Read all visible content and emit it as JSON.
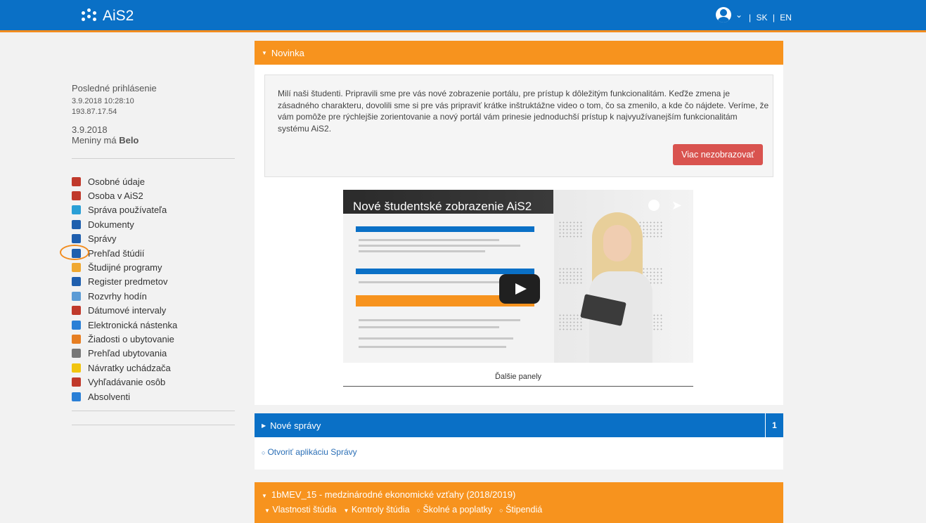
{
  "header": {
    "app_title": "AiS2",
    "lang_sep": "|",
    "lang_sk": "SK",
    "lang_en": "EN"
  },
  "sidebar": {
    "last_login_label": "Posledné prihlásenie",
    "last_login_time": "3.9.2018 10:28:10",
    "ip": "193.87.17.54",
    "date": "3.9.2018",
    "nameday_prefix": "Meniny má",
    "nameday_name": "Belo",
    "items": [
      {
        "label": "Osobné údaje",
        "color": "#c0392b"
      },
      {
        "label": "Osoba v AiS2",
        "color": "#c0392b"
      },
      {
        "label": "Správa používateľa",
        "color": "#2a9fd6"
      },
      {
        "label": "Dokumenty",
        "color": "#1f5fae"
      },
      {
        "label": "Správy",
        "color": "#1f5fae"
      },
      {
        "label": "Prehľad štúdií",
        "color": "#1f5fae"
      },
      {
        "label": "Študijné programy",
        "color": "#f0a830"
      },
      {
        "label": "Register predmetov",
        "color": "#1f5fae"
      },
      {
        "label": "Rozvrhy hodín",
        "color": "#5b9bd5"
      },
      {
        "label": "Dátumové intervaly",
        "color": "#c0392b"
      },
      {
        "label": "Elektronická nástenka",
        "color": "#2a7fd6"
      },
      {
        "label": "Žiadosti o ubytovanie",
        "color": "#e67e22"
      },
      {
        "label": "Prehľad ubytovania",
        "color": "#777777"
      },
      {
        "label": "Návratky uchádzača",
        "color": "#f1c40f"
      },
      {
        "label": "Vyhľadávanie osôb",
        "color": "#c0392b"
      },
      {
        "label": "Absolventi",
        "color": "#2a7fd6"
      }
    ]
  },
  "novinka": {
    "title": "Novinka",
    "text": "Milí naši študenti. Pripravili sme pre vás nové zobrazenie portálu, pre prístup k dôležitým funkcionalitám. Keďže zmena je zásadného charakteru, dovolili sme si pre vás pripraviť krátke inštruktážne video o tom, čo sa zmenilo, a kde čo nájdete. Veríme, že vám pomôže pre rýchlejšie zorientovanie a nový portál vám prinesie jednoduchší prístup k najvyužívanejším funkcionalitám systému AiS2.",
    "button": "Viac nezobrazovať",
    "video_title": "Nové študentské zobrazenie AiS2",
    "video_caption": "Ďalšie panely"
  },
  "spravy": {
    "title": "Nové správy",
    "count": "1",
    "link": "Otvoriť aplikáciu Správy"
  },
  "studium": {
    "title": "1bMEV_15 - medzinárodné ekonomické vzťahy (2018/2019)",
    "links": [
      "Vlastnosti štúdia",
      "Kontroly štúdia",
      "Školné a poplatky",
      "Štipendiá"
    ]
  }
}
